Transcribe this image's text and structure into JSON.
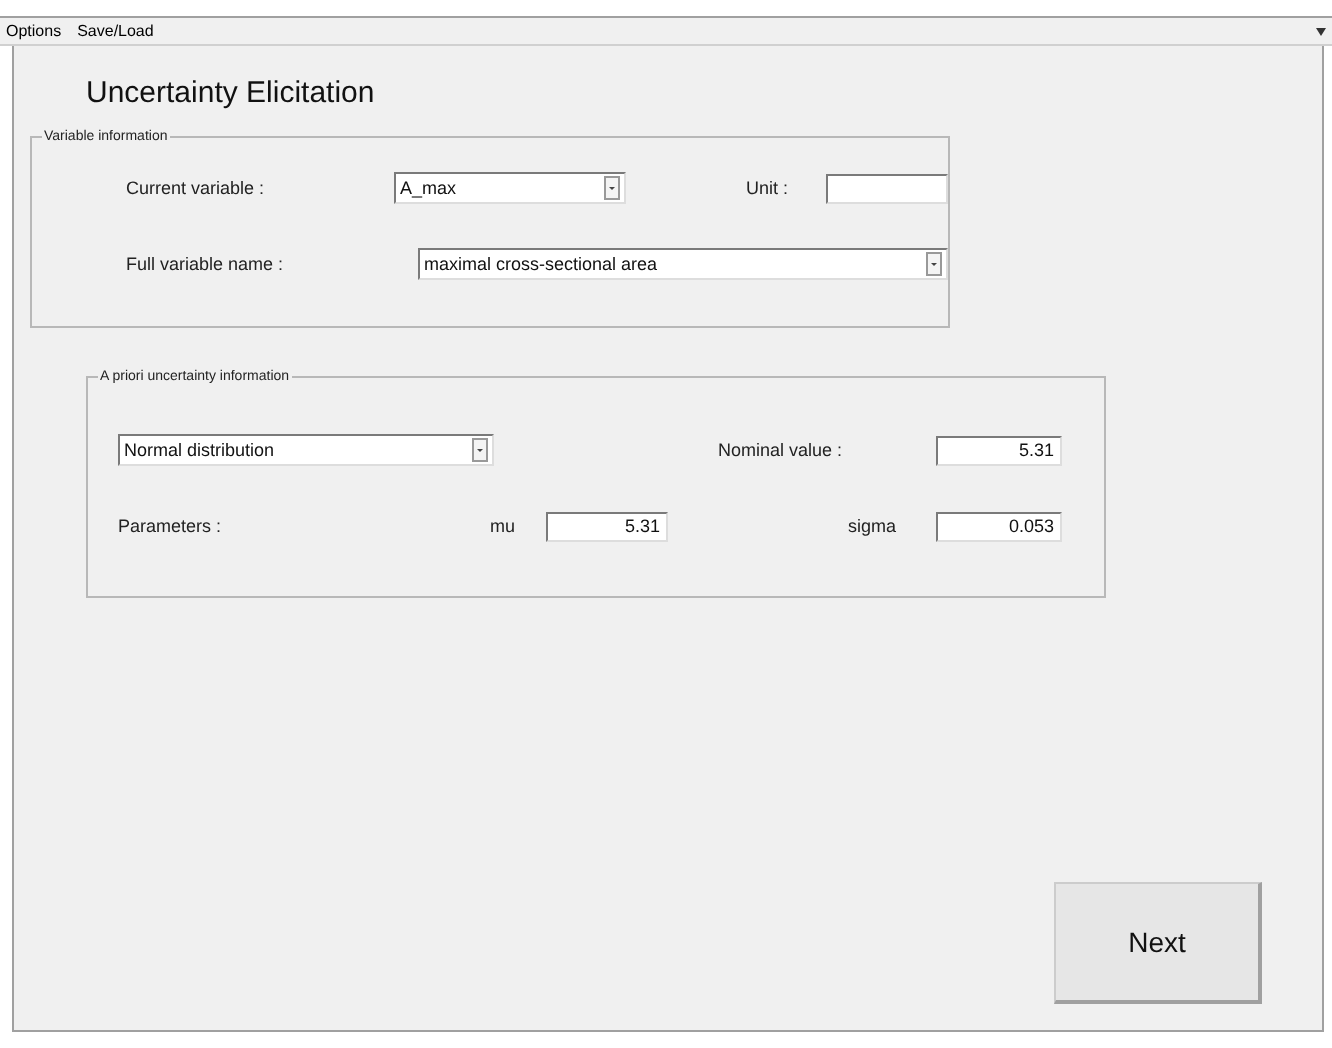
{
  "menu": [
    "Options",
    "Save/Load"
  ],
  "title": "Uncertainty Elicitation",
  "variable_information": {
    "legend": "Variable information",
    "current_variable": {
      "label": "Current variable :",
      "value": "A_max"
    },
    "unit": {
      "label": "Unit :"
    },
    "full_variable_name": {
      "label": "Full variable name :",
      "value": "maximal cross-sectional area"
    }
  },
  "a_priori_uncertainty_information": {
    "legend": "A priori uncertainty information",
    "distribution": {
      "value": "Normal distribution"
    },
    "nominal_value": {
      "label": "Nominal value :",
      "value": "5.31"
    },
    "parameters_label": "Parameters :",
    "parameters": [
      {
        "label": "mu",
        "value": "5.31"
      },
      {
        "label": "sigma",
        "value": "0.053"
      }
    ]
  },
  "buttons": [
    "Next"
  ]
}
